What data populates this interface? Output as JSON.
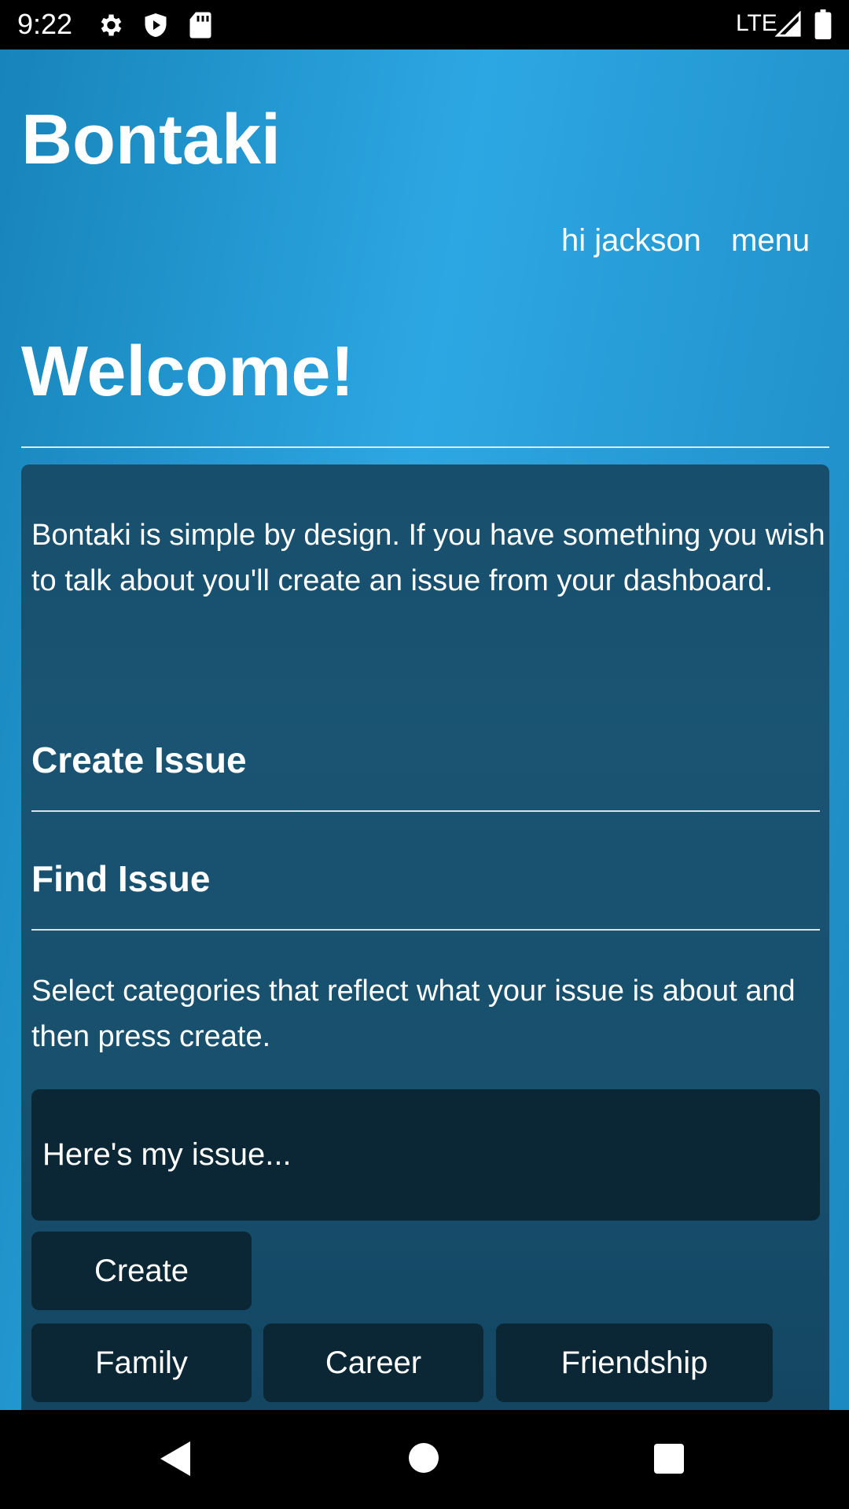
{
  "status_bar": {
    "time": "9:22",
    "icons": [
      "gear-icon",
      "shield-play-icon",
      "sd-card-icon",
      "signal-icon",
      "battery-icon"
    ],
    "network": "LTE"
  },
  "header": {
    "brand": "Bontaki",
    "greeting": "hi jackson",
    "menu_label": "menu"
  },
  "page": {
    "title": "Welcome!"
  },
  "card": {
    "intro": "Bontaki is simple by design. If you have something you wish to talk about you'll create an issue from your dashboard.",
    "create_issue_heading": "Create Issue",
    "find_issue_heading": "Find Issue",
    "instructions": "Select categories that reflect what your issue is about and then press create.",
    "issue_placeholder": "Here's my issue...",
    "create_button": "Create",
    "categories": [
      "Family",
      "Career",
      "Friendship"
    ]
  },
  "colors": {
    "header_gradient_light": "#2da7e3",
    "header_gradient_dark": "#1784ba",
    "card_background": "#1a5473",
    "control_background": "#0b2634"
  },
  "navigation_bar": {
    "icons": [
      "back-triangle-icon",
      "home-circle-icon",
      "recents-square-icon"
    ]
  }
}
